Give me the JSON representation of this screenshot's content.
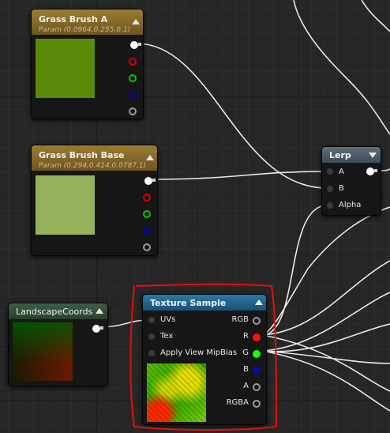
{
  "nodes": {
    "grass_a": {
      "title": "Grass Brush A",
      "param": "Param (0.0964,0.255,0.1)",
      "color": "#5a8a08"
    },
    "grass_base": {
      "title": "Grass Brush Base",
      "param": "Param (0.294,0.414,0.0787,1)",
      "color": "#96b25a"
    },
    "lerp": {
      "title": "Lerp",
      "inputs": [
        "A",
        "B",
        "Alpha"
      ]
    },
    "landscape": {
      "title": "LandscapeCoords"
    },
    "texture": {
      "title": "Texture Sample",
      "inputs": [
        "UVs",
        "Tex",
        "Apply View MipBias"
      ],
      "outputs": [
        "RGB",
        "R",
        "G",
        "B",
        "A",
        "RGBA"
      ]
    }
  },
  "colors": {
    "header_param": "#8a6e2a",
    "header_texture": "#1f5f86",
    "header_lerp": "#4a5a66",
    "header_coords": "#35503a",
    "highlight": "#e01010"
  }
}
